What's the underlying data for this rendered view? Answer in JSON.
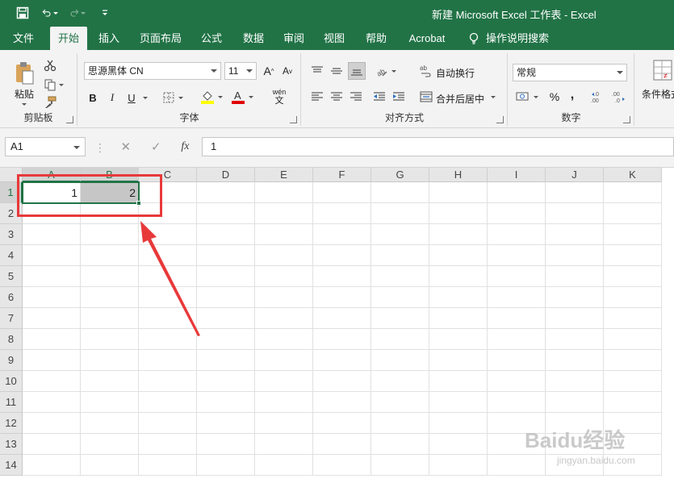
{
  "title_bar": {
    "document_title": "新建 Microsoft Excel 工作表  -  Excel",
    "qat_icons": [
      "save-icon",
      "undo-icon",
      "redo-icon",
      "customize-qat-icon"
    ]
  },
  "tabs": [
    {
      "label": "文件"
    },
    {
      "label": "开始"
    },
    {
      "label": "插入"
    },
    {
      "label": "页面布局"
    },
    {
      "label": "公式"
    },
    {
      "label": "数据"
    },
    {
      "label": "审阅"
    },
    {
      "label": "视图"
    },
    {
      "label": "帮助"
    },
    {
      "label": "Acrobat"
    }
  ],
  "active_tab": "开始",
  "tell_me": "操作说明搜索",
  "ribbon": {
    "clipboard": {
      "label": "剪贴板",
      "paste_label": "粘贴"
    },
    "font": {
      "label": "字体",
      "font_name": "思源黑体 CN",
      "font_size": "11",
      "bold": "B",
      "italic": "I",
      "underline": "U",
      "phonetic": "wén"
    },
    "alignment": {
      "label": "对齐方式",
      "wrap_text": "自动换行",
      "merge_center": "合并后居中"
    },
    "number": {
      "label": "数字",
      "format": "常规",
      "percent": "%",
      "comma": ","
    },
    "styles": {
      "cond_format_label": "条件格式"
    }
  },
  "formula_bar": {
    "name_box": "A1",
    "fx": "fx",
    "content": "1"
  },
  "grid": {
    "columns": [
      "A",
      "B",
      "C",
      "D",
      "E",
      "F",
      "G",
      "H",
      "I",
      "J",
      "K"
    ],
    "rows": [
      "1",
      "2",
      "3",
      "4",
      "5",
      "6",
      "7",
      "8",
      "9",
      "10",
      "11",
      "12",
      "13",
      "14"
    ],
    "cells": {
      "A1": "1",
      "B1": "2"
    },
    "selected_range": "A1:B1"
  },
  "colors": {
    "excel_green": "#217346",
    "annotation_red": "#e8393a",
    "selection_fill": "#c6c6c6"
  },
  "watermark": {
    "main": "Baidu经验",
    "sub": "jingyan.baidu.com"
  }
}
